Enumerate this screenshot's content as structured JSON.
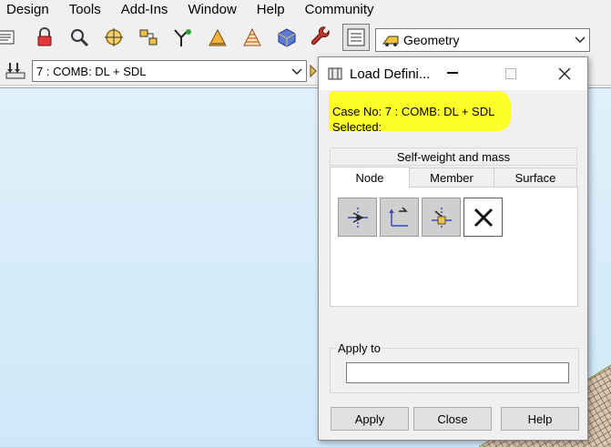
{
  "menu": [
    "Design",
    "Tools",
    "Add-Ins",
    "Window",
    "Help",
    "Community"
  ],
  "toolbar": {
    "view_combo": "Geometry",
    "load_case_combo": "7 : COMB: DL + SDL"
  },
  "dialog": {
    "title": "Load Defini...",
    "case_line": "Case No: 7 : COMB: DL + SDL",
    "selected_line": "Selected:",
    "self_weight": "Self-weight and mass",
    "tabs": [
      "Node",
      "Member",
      "Surface"
    ],
    "apply_to_label": "Apply to",
    "apply_to_value": "",
    "buttons": {
      "apply": "Apply",
      "close": "Close",
      "help": "Help"
    }
  },
  "colors": {
    "highlight": "#ffff2a",
    "viewport": "#d6ecfa"
  }
}
